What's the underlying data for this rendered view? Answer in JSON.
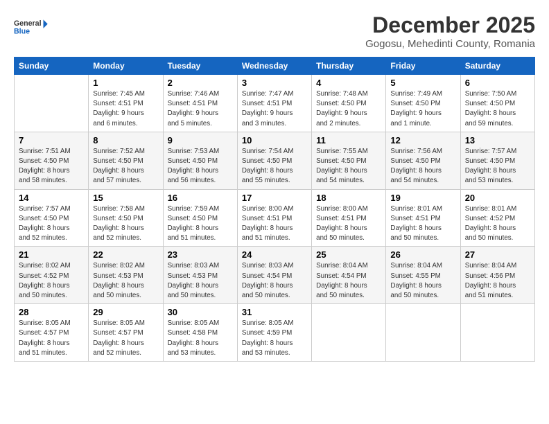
{
  "logo": {
    "line1": "General",
    "line2": "Blue"
  },
  "title": "December 2025",
  "subtitle": "Gogosu, Mehedinti County, Romania",
  "days_header": [
    "Sunday",
    "Monday",
    "Tuesday",
    "Wednesday",
    "Thursday",
    "Friday",
    "Saturday"
  ],
  "weeks": [
    [
      {
        "day": "",
        "info": ""
      },
      {
        "day": "1",
        "info": "Sunrise: 7:45 AM\nSunset: 4:51 PM\nDaylight: 9 hours\nand 6 minutes."
      },
      {
        "day": "2",
        "info": "Sunrise: 7:46 AM\nSunset: 4:51 PM\nDaylight: 9 hours\nand 5 minutes."
      },
      {
        "day": "3",
        "info": "Sunrise: 7:47 AM\nSunset: 4:51 PM\nDaylight: 9 hours\nand 3 minutes."
      },
      {
        "day": "4",
        "info": "Sunrise: 7:48 AM\nSunset: 4:50 PM\nDaylight: 9 hours\nand 2 minutes."
      },
      {
        "day": "5",
        "info": "Sunrise: 7:49 AM\nSunset: 4:50 PM\nDaylight: 9 hours\nand 1 minute."
      },
      {
        "day": "6",
        "info": "Sunrise: 7:50 AM\nSunset: 4:50 PM\nDaylight: 8 hours\nand 59 minutes."
      }
    ],
    [
      {
        "day": "7",
        "info": "Sunrise: 7:51 AM\nSunset: 4:50 PM\nDaylight: 8 hours\nand 58 minutes."
      },
      {
        "day": "8",
        "info": "Sunrise: 7:52 AM\nSunset: 4:50 PM\nDaylight: 8 hours\nand 57 minutes."
      },
      {
        "day": "9",
        "info": "Sunrise: 7:53 AM\nSunset: 4:50 PM\nDaylight: 8 hours\nand 56 minutes."
      },
      {
        "day": "10",
        "info": "Sunrise: 7:54 AM\nSunset: 4:50 PM\nDaylight: 8 hours\nand 55 minutes."
      },
      {
        "day": "11",
        "info": "Sunrise: 7:55 AM\nSunset: 4:50 PM\nDaylight: 8 hours\nand 54 minutes."
      },
      {
        "day": "12",
        "info": "Sunrise: 7:56 AM\nSunset: 4:50 PM\nDaylight: 8 hours\nand 54 minutes."
      },
      {
        "day": "13",
        "info": "Sunrise: 7:57 AM\nSunset: 4:50 PM\nDaylight: 8 hours\nand 53 minutes."
      }
    ],
    [
      {
        "day": "14",
        "info": "Sunrise: 7:57 AM\nSunset: 4:50 PM\nDaylight: 8 hours\nand 52 minutes."
      },
      {
        "day": "15",
        "info": "Sunrise: 7:58 AM\nSunset: 4:50 PM\nDaylight: 8 hours\nand 52 minutes."
      },
      {
        "day": "16",
        "info": "Sunrise: 7:59 AM\nSunset: 4:50 PM\nDaylight: 8 hours\nand 51 minutes."
      },
      {
        "day": "17",
        "info": "Sunrise: 8:00 AM\nSunset: 4:51 PM\nDaylight: 8 hours\nand 51 minutes."
      },
      {
        "day": "18",
        "info": "Sunrise: 8:00 AM\nSunset: 4:51 PM\nDaylight: 8 hours\nand 50 minutes."
      },
      {
        "day": "19",
        "info": "Sunrise: 8:01 AM\nSunset: 4:51 PM\nDaylight: 8 hours\nand 50 minutes."
      },
      {
        "day": "20",
        "info": "Sunrise: 8:01 AM\nSunset: 4:52 PM\nDaylight: 8 hours\nand 50 minutes."
      }
    ],
    [
      {
        "day": "21",
        "info": "Sunrise: 8:02 AM\nSunset: 4:52 PM\nDaylight: 8 hours\nand 50 minutes."
      },
      {
        "day": "22",
        "info": "Sunrise: 8:02 AM\nSunset: 4:53 PM\nDaylight: 8 hours\nand 50 minutes."
      },
      {
        "day": "23",
        "info": "Sunrise: 8:03 AM\nSunset: 4:53 PM\nDaylight: 8 hours\nand 50 minutes."
      },
      {
        "day": "24",
        "info": "Sunrise: 8:03 AM\nSunset: 4:54 PM\nDaylight: 8 hours\nand 50 minutes."
      },
      {
        "day": "25",
        "info": "Sunrise: 8:04 AM\nSunset: 4:54 PM\nDaylight: 8 hours\nand 50 minutes."
      },
      {
        "day": "26",
        "info": "Sunrise: 8:04 AM\nSunset: 4:55 PM\nDaylight: 8 hours\nand 50 minutes."
      },
      {
        "day": "27",
        "info": "Sunrise: 8:04 AM\nSunset: 4:56 PM\nDaylight: 8 hours\nand 51 minutes."
      }
    ],
    [
      {
        "day": "28",
        "info": "Sunrise: 8:05 AM\nSunset: 4:57 PM\nDaylight: 8 hours\nand 51 minutes."
      },
      {
        "day": "29",
        "info": "Sunrise: 8:05 AM\nSunset: 4:57 PM\nDaylight: 8 hours\nand 52 minutes."
      },
      {
        "day": "30",
        "info": "Sunrise: 8:05 AM\nSunset: 4:58 PM\nDaylight: 8 hours\nand 53 minutes."
      },
      {
        "day": "31",
        "info": "Sunrise: 8:05 AM\nSunset: 4:59 PM\nDaylight: 8 hours\nand 53 minutes."
      },
      {
        "day": "",
        "info": ""
      },
      {
        "day": "",
        "info": ""
      },
      {
        "day": "",
        "info": ""
      }
    ]
  ]
}
